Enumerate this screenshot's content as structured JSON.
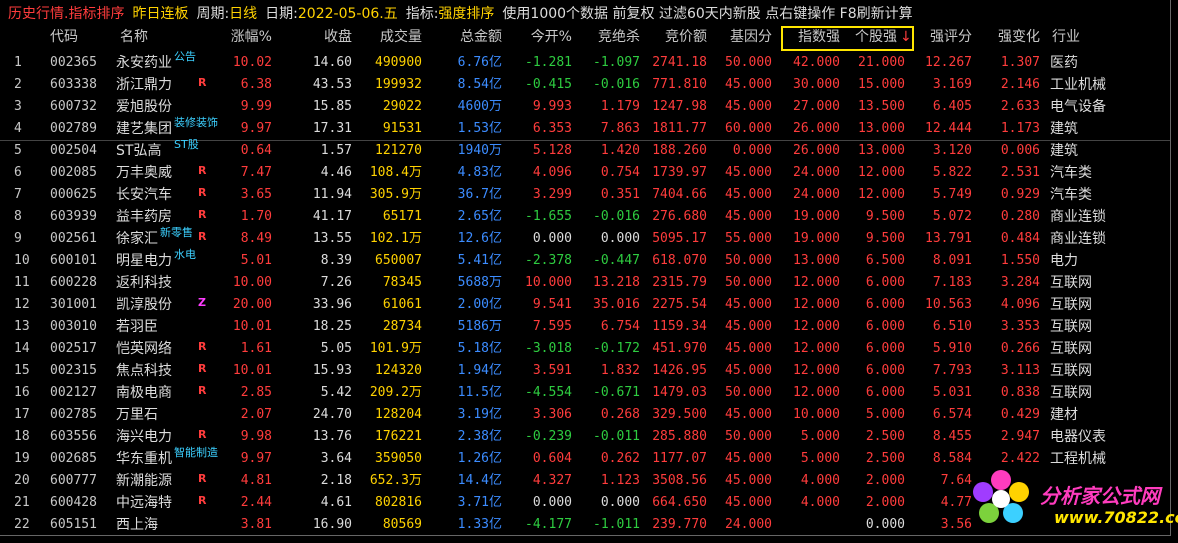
{
  "topbar": {
    "mode": "历史行情.指标排序",
    "period_value": "昨日连板",
    "period_label": "周期:",
    "period_type": "日线",
    "date_label": "日期:",
    "date_value": "2022-05-06.五",
    "indicator_label": "指标:",
    "indicator_value": "强度排序",
    "info": "使用1000个数据 前复权 过滤60天内新股 点右键操作 F8刷新计算"
  },
  "headers": {
    "code": "代码",
    "name": "名称",
    "pct": "涨幅%",
    "close": "收盘",
    "volume": "成交量",
    "amount": "总金额",
    "open_pct": "今开%",
    "auction_kill": "竞绝杀",
    "auction_amount": "竞价额",
    "base_factor": "基因分",
    "index_strength": "指数强",
    "stock_strength": "个股强",
    "sort_arrow": "↓",
    "strength_score": "强评分",
    "strength_change": "强变化",
    "industry": "行业"
  },
  "rows": [
    {
      "idx": "1",
      "code": "002365",
      "name": "永安药业",
      "tag": "公告",
      "flag": "",
      "pct": "10.02",
      "close": "14.60",
      "vol": "490900",
      "amt": "6.76",
      "unit": "亿",
      "open": "-1.281",
      "kill": "-1.097",
      "auc": "2741.18",
      "base": "50.000",
      "istr": "42.000",
      "sstr": "21.000",
      "score": "12.267",
      "chg": "1.307",
      "ind": "医药"
    },
    {
      "idx": "2",
      "code": "603338",
      "name": "浙江鼎力",
      "tag": "",
      "flag": "R",
      "pct": "6.38",
      "close": "43.53",
      "vol": "199932",
      "amt": "8.54",
      "unit": "亿",
      "open": "-0.415",
      "kill": "-0.016",
      "auc": "771.810",
      "base": "45.000",
      "istr": "30.000",
      "sstr": "15.000",
      "score": "3.169",
      "chg": "2.146",
      "ind": "工业机械"
    },
    {
      "idx": "3",
      "code": "600732",
      "name": "爱旭股份",
      "tag": "",
      "flag": "",
      "pct": "9.99",
      "close": "15.85",
      "vol": "29022",
      "amt": "4600",
      "unit": "万",
      "open": "9.993",
      "kill": "1.179",
      "auc": "1247.98",
      "base": "45.000",
      "istr": "27.000",
      "sstr": "13.500",
      "score": "6.405",
      "chg": "2.633",
      "ind": "电气设备"
    },
    {
      "idx": "4",
      "code": "002789",
      "name": "建艺集团",
      "tag": "装修装饰",
      "flag": "",
      "pct": "9.97",
      "close": "17.31",
      "vol": "91531",
      "amt": "1.53",
      "unit": "亿",
      "open": "6.353",
      "kill": "7.863",
      "auc": "1811.77",
      "base": "60.000",
      "istr": "26.000",
      "sstr": "13.000",
      "score": "12.444",
      "chg": "1.173",
      "ind": "建筑"
    },
    {
      "idx": "5",
      "code": "002504",
      "name": "ST弘高",
      "tag": "ST股",
      "flag": "",
      "pct": "0.64",
      "close": "1.57",
      "vol": "121270",
      "amt": "1940",
      "unit": "万",
      "open": "5.128",
      "kill": "1.420",
      "auc": "188.260",
      "base": "0.000",
      "istr": "26.000",
      "sstr": "13.000",
      "score": "3.120",
      "chg": "0.006",
      "ind": "建筑"
    },
    {
      "idx": "6",
      "code": "002085",
      "name": "万丰奥威",
      "tag": "",
      "flag": "R",
      "pct": "7.47",
      "close": "4.46",
      "vol": "108.4万",
      "amt": "4.83",
      "unit": "亿",
      "open": "4.096",
      "kill": "0.754",
      "auc": "1739.97",
      "base": "45.000",
      "istr": "24.000",
      "sstr": "12.000",
      "score": "5.822",
      "chg": "2.531",
      "ind": "汽车类"
    },
    {
      "idx": "7",
      "code": "000625",
      "name": "长安汽车",
      "tag": "",
      "flag": "R",
      "pct": "3.65",
      "close": "11.94",
      "vol": "305.9万",
      "amt": "36.7",
      "unit": "亿",
      "open": "3.299",
      "kill": "0.351",
      "auc": "7404.66",
      "base": "45.000",
      "istr": "24.000",
      "sstr": "12.000",
      "score": "5.749",
      "chg": "0.929",
      "ind": "汽车类"
    },
    {
      "idx": "8",
      "code": "603939",
      "name": "益丰药房",
      "tag": "",
      "flag": "R",
      "pct": "1.70",
      "close": "41.17",
      "vol": "65171",
      "amt": "2.65",
      "unit": "亿",
      "open": "-1.655",
      "kill": "-0.016",
      "auc": "276.680",
      "base": "45.000",
      "istr": "19.000",
      "sstr": "9.500",
      "score": "5.072",
      "chg": "0.280",
      "ind": "商业连锁"
    },
    {
      "idx": "9",
      "code": "002561",
      "name": "徐家汇",
      "tag": "新零售",
      "flag": "R",
      "pct": "8.49",
      "close": "13.55",
      "vol": "102.1万",
      "amt": "12.6",
      "unit": "亿",
      "open": "0.000",
      "kill": "0.000",
      "auc": "5095.17",
      "base": "55.000",
      "istr": "19.000",
      "sstr": "9.500",
      "score": "13.791",
      "chg": "0.484",
      "ind": "商业连锁"
    },
    {
      "idx": "10",
      "code": "600101",
      "name": "明星电力",
      "tag": "水电",
      "flag": "",
      "pct": "5.01",
      "close": "8.39",
      "vol": "650007",
      "amt": "5.41",
      "unit": "亿",
      "open": "-2.378",
      "kill": "-0.447",
      "auc": "618.070",
      "base": "50.000",
      "istr": "13.000",
      "sstr": "6.500",
      "score": "8.091",
      "chg": "1.550",
      "ind": "电力"
    },
    {
      "idx": "11",
      "code": "600228",
      "name": "返利科技",
      "tag": "",
      "flag": "",
      "pct": "10.00",
      "close": "7.26",
      "vol": "78345",
      "amt": "5688",
      "unit": "万",
      "open": "10.000",
      "kill": "13.218",
      "auc": "2315.79",
      "base": "50.000",
      "istr": "12.000",
      "sstr": "6.000",
      "score": "7.183",
      "chg": "3.284",
      "ind": "互联网"
    },
    {
      "idx": "12",
      "code": "301001",
      "name": "凯淳股份",
      "tag": "",
      "flag": "Z",
      "pct": "20.00",
      "close": "33.96",
      "vol": "61061",
      "amt": "2.00",
      "unit": "亿",
      "open": "9.541",
      "kill": "35.016",
      "auc": "2275.54",
      "base": "45.000",
      "istr": "12.000",
      "sstr": "6.000",
      "score": "10.563",
      "chg": "4.096",
      "ind": "互联网"
    },
    {
      "idx": "13",
      "code": "003010",
      "name": "若羽臣",
      "tag": "",
      "flag": "",
      "pct": "10.01",
      "close": "18.25",
      "vol": "28734",
      "amt": "5186",
      "unit": "万",
      "open": "7.595",
      "kill": "6.754",
      "auc": "1159.34",
      "base": "45.000",
      "istr": "12.000",
      "sstr": "6.000",
      "score": "6.510",
      "chg": "3.353",
      "ind": "互联网"
    },
    {
      "idx": "14",
      "code": "002517",
      "name": "恺英网络",
      "tag": "",
      "flag": "R",
      "pct": "1.61",
      "close": "5.05",
      "vol": "101.9万",
      "amt": "5.18",
      "unit": "亿",
      "open": "-3.018",
      "kill": "-0.172",
      "auc": "451.970",
      "base": "45.000",
      "istr": "12.000",
      "sstr": "6.000",
      "score": "5.910",
      "chg": "0.266",
      "ind": "互联网"
    },
    {
      "idx": "15",
      "code": "002315",
      "name": "焦点科技",
      "tag": "",
      "flag": "R",
      "pct": "10.01",
      "close": "15.93",
      "vol": "124320",
      "amt": "1.94",
      "unit": "亿",
      "open": "3.591",
      "kill": "1.832",
      "auc": "1426.95",
      "base": "45.000",
      "istr": "12.000",
      "sstr": "6.000",
      "score": "7.793",
      "chg": "3.113",
      "ind": "互联网"
    },
    {
      "idx": "16",
      "code": "002127",
      "name": "南极电商",
      "tag": "",
      "flag": "R",
      "pct": "2.85",
      "close": "5.42",
      "vol": "209.2万",
      "amt": "11.5",
      "unit": "亿",
      "open": "-4.554",
      "kill": "-0.671",
      "auc": "1479.03",
      "base": "50.000",
      "istr": "12.000",
      "sstr": "6.000",
      "score": "5.031",
      "chg": "0.838",
      "ind": "互联网"
    },
    {
      "idx": "17",
      "code": "002785",
      "name": "万里石",
      "tag": "",
      "flag": "",
      "pct": "2.07",
      "close": "24.70",
      "vol": "128204",
      "amt": "3.19",
      "unit": "亿",
      "open": "3.306",
      "kill": "0.268",
      "auc": "329.500",
      "base": "45.000",
      "istr": "10.000",
      "sstr": "5.000",
      "score": "6.574",
      "chg": "0.429",
      "ind": "建材"
    },
    {
      "idx": "18",
      "code": "603556",
      "name": "海兴电力",
      "tag": "",
      "flag": "R",
      "pct": "9.98",
      "close": "13.76",
      "vol": "176221",
      "amt": "2.38",
      "unit": "亿",
      "open": "-0.239",
      "kill": "-0.011",
      "auc": "285.880",
      "base": "50.000",
      "istr": "5.000",
      "sstr": "2.500",
      "score": "8.455",
      "chg": "2.947",
      "ind": "电器仪表"
    },
    {
      "idx": "19",
      "code": "002685",
      "name": "华东重机",
      "tag": "智能制造",
      "flag": "",
      "pct": "9.97",
      "close": "3.64",
      "vol": "359050",
      "amt": "1.26",
      "unit": "亿",
      "open": "0.604",
      "kill": "0.262",
      "auc": "1177.07",
      "base": "45.000",
      "istr": "5.000",
      "sstr": "2.500",
      "score": "8.584",
      "chg": "2.422",
      "ind": "工程机械"
    },
    {
      "idx": "20",
      "code": "600777",
      "name": "新潮能源",
      "tag": "",
      "flag": "R",
      "pct": "4.81",
      "close": "2.18",
      "vol": "652.3万",
      "amt": "14.4",
      "unit": "亿",
      "open": "4.327",
      "kill": "1.123",
      "auc": "3508.56",
      "base": "45.000",
      "istr": "4.000",
      "sstr": "2.000",
      "score": "7.64",
      "chg": "",
      "ind": ""
    },
    {
      "idx": "21",
      "code": "600428",
      "name": "中远海特",
      "tag": "",
      "flag": "R",
      "pct": "2.44",
      "close": "4.61",
      "vol": "802816",
      "amt": "3.71",
      "unit": "亿",
      "open": "0.000",
      "kill": "0.000",
      "auc": "664.650",
      "base": "45.000",
      "istr": "4.000",
      "sstr": "2.000",
      "score": "4.77",
      "chg": "",
      "ind": ""
    },
    {
      "idx": "22",
      "code": "605151",
      "name": "西上海",
      "tag": "",
      "flag": "",
      "pct": "3.81",
      "close": "16.90",
      "vol": "80569",
      "amt": "1.33",
      "unit": "亿",
      "open": "-4.177",
      "kill": "-1.011",
      "auc": "239.770",
      "base": "24.000",
      "istr": "",
      "sstr": "0.000",
      "score": "3.56",
      "chg": "",
      "ind": ""
    }
  ],
  "logo": {
    "text": "分析家公式网",
    "url": "www.70822.com"
  },
  "colors": {
    "up": "#ff3c3c",
    "down": "#2ecc40",
    "flat": "#dcdcdc",
    "volume": "#ffd200",
    "highlight_box": "#ffe600"
  }
}
